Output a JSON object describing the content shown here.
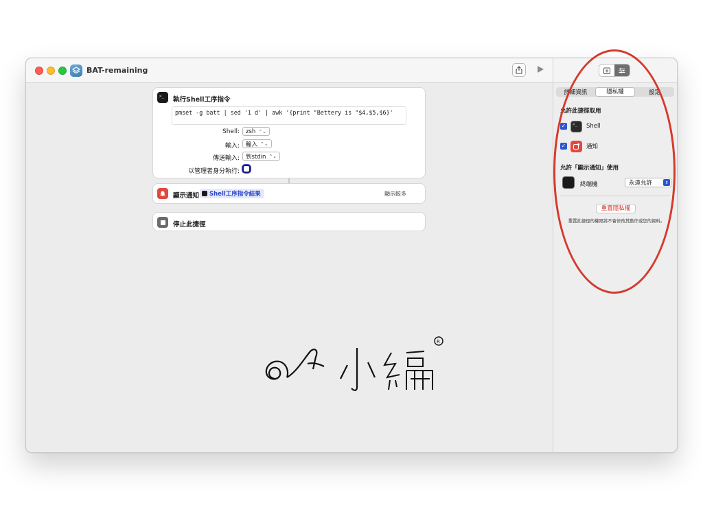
{
  "window": {
    "title": "BAT-remaining"
  },
  "actions": {
    "shell": {
      "title": "執行Shell工序指令",
      "script": "pmset -g batt | sed '1 d' | awk '{print \"Bettery is \"$4,$5,$6}'",
      "shell_label": "Shell:",
      "shell_value": "zsh",
      "input_label": "輸入:",
      "input_value": "輸入",
      "pass_input_label": "傳送輸入:",
      "pass_input_value": "到stdin",
      "admin_label": "以管理者身分執行:"
    },
    "notify": {
      "title": "顯示通知",
      "variable": "Shell工序指令結果",
      "show_more": "顯示較多"
    },
    "stop": {
      "title": "停止此捷徑"
    }
  },
  "sidebar": {
    "tabs": [
      "詳細資訊",
      "隱私權",
      "設定"
    ],
    "active_tab": "隱私權",
    "allow_heading": "允許此捷徑取用",
    "permissions": [
      {
        "label": "Shell",
        "checked": true,
        "icon": "terminal-icon"
      },
      {
        "label": "通知",
        "checked": true,
        "icon": "notification-icon"
      }
    ],
    "notify_heading": "允許「顯示通知」使用",
    "terminal_label": "終端機",
    "terminal_value": "永遠允許",
    "reset_button": "重置隱私權",
    "reset_note": "重置此捷徑的權限將不會修改其動作或您的資料。"
  },
  "colors": {
    "accent": "#2c55d4",
    "annotation": "#d63a2c",
    "notify_red": "#e2483f",
    "close": "#fe5f57",
    "minimize": "#febc2e",
    "zoom": "#28c840"
  },
  "watermark": {
    "text": "小編"
  }
}
